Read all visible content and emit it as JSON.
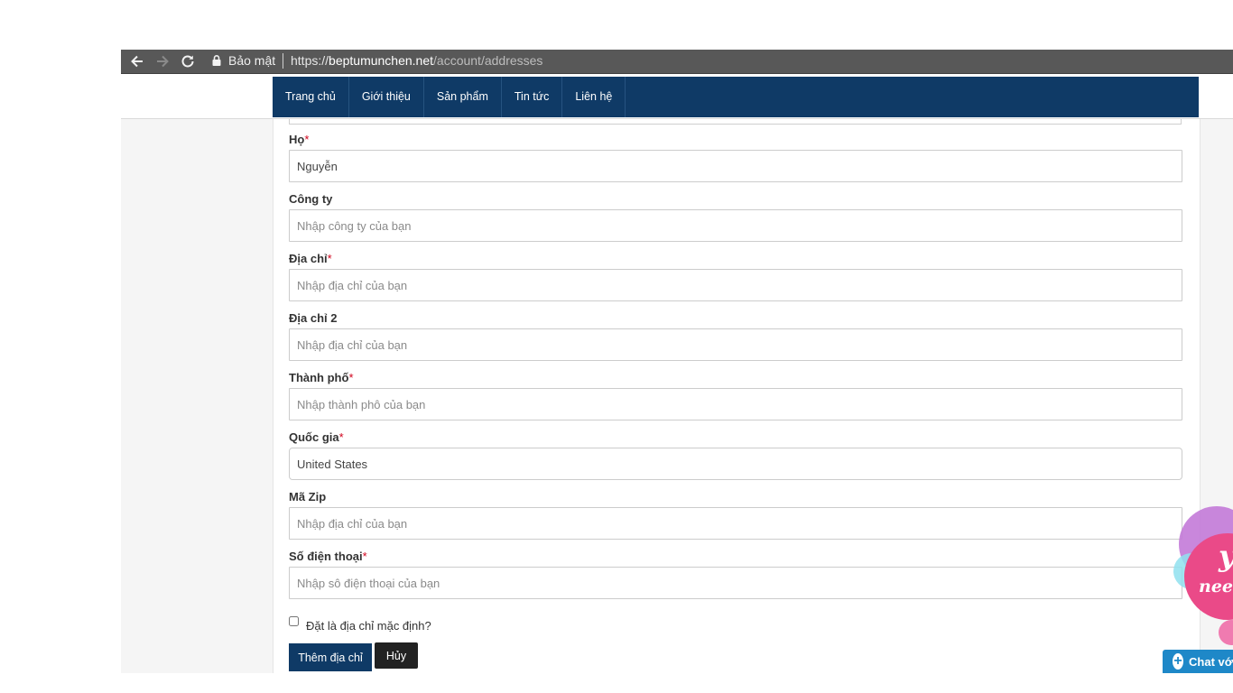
{
  "browser": {
    "secure_label": "Bảo mật",
    "url_scheme": "https://",
    "url_host": "beptumunchen.net",
    "url_path": "/account/addresses"
  },
  "nav": {
    "items": [
      {
        "label": "Trang chủ"
      },
      {
        "label": "Giới thiệu"
      },
      {
        "label": "Sản phẩm"
      },
      {
        "label": "Tin tức"
      },
      {
        "label": "Liên hệ"
      }
    ]
  },
  "form": {
    "required_mark": "*",
    "last_name": {
      "label": "Họ",
      "value": "Nguyễn",
      "placeholder": ""
    },
    "company": {
      "label": "Công ty",
      "placeholder": "Nhập công ty của bạn"
    },
    "address1": {
      "label": "Địa chỉ",
      "placeholder": "Nhập địa chỉ của bạn"
    },
    "address2": {
      "label": "Địa chỉ 2",
      "placeholder": "Nhập địa chỉ của bạn"
    },
    "city": {
      "label": "Thành phố",
      "placeholder": "Nhập thành phô của bạn"
    },
    "country": {
      "label": "Quốc gia",
      "selected": "United States"
    },
    "zip": {
      "label": "Mã Zip",
      "placeholder": "Nhập địa chỉ của bạn"
    },
    "phone": {
      "label": "Số điện thoại",
      "placeholder": "Nhập sô điện thoại của bạn"
    },
    "default_checkbox_label": "Đặt là địa chỉ mặc định?",
    "default_checked": false,
    "submit_label": "Thêm địa chỉ",
    "cancel_label": "Hủy"
  },
  "widgets": {
    "chat_label": "Chat vớ",
    "promo_text_1": "y",
    "promo_text_2": "nee"
  },
  "colors": {
    "nav_bg": "#0f3a66",
    "required": "#d0021b",
    "cancel_bg": "#222222",
    "chat_bg": "#1e88c8"
  }
}
